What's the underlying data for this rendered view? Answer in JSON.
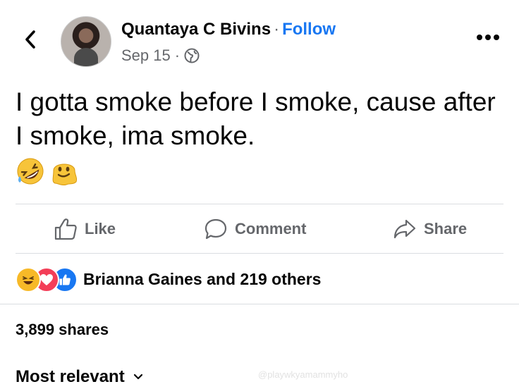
{
  "post": {
    "author": "Quantaya C Bivins",
    "separator": "·",
    "follow_label": "Follow",
    "date": "Sep 15",
    "meta_separator": "·",
    "privacy_icon": "globe-icon",
    "text": "I gotta smoke before I smoke, cause after I smoke, ima smoke.",
    "emojis": [
      "rolling-on-floor-laughing-emoji",
      "melting-face-emoji"
    ]
  },
  "actions": {
    "like_label": "Like",
    "comment_label": "Comment",
    "share_label": "Share"
  },
  "reactions": {
    "icons": [
      "haha-reaction-icon",
      "love-reaction-icon",
      "like-reaction-icon"
    ],
    "summary": "Brianna Gaines and 219 others"
  },
  "shares_text": "3,899 shares",
  "comments_sort": {
    "label": "Most relevant"
  },
  "watermark": "@playwkyamammyho",
  "colors": {
    "link_blue": "#1877f2",
    "secondary_text": "#65676b",
    "divider": "#dadde1",
    "haha_yellow": "#f7b928",
    "love_red": "#f33e58"
  }
}
